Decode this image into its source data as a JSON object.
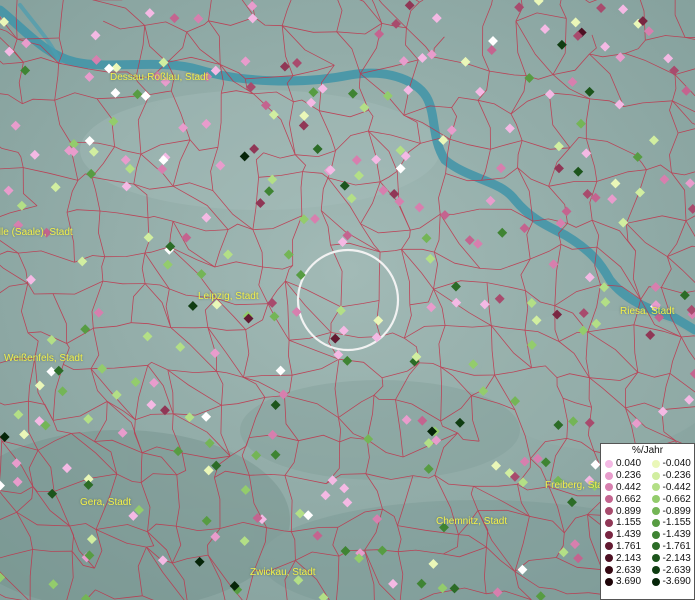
{
  "map": {
    "places": [
      {
        "name": "Dessau-Roßlau, Stadt"
      },
      {
        "name": "Halle (Saale), Stadt"
      },
      {
        "name": "Leipzig, Stadt"
      },
      {
        "name": "Weißenfels, Stadt"
      },
      {
        "name": "Riesa, Stadt"
      },
      {
        "name": "Gera, Stadt"
      },
      {
        "name": "Freiberg, Stadt"
      },
      {
        "name": "Chemnitz, Stadt"
      },
      {
        "name": "Zwickau, Stadt"
      }
    ]
  },
  "legend": {
    "unit": "%/Jahr",
    "positive": [
      {
        "label": "0.040",
        "color": "#f4b9e4"
      },
      {
        "label": "0.236",
        "color": "#e89ccc"
      },
      {
        "label": "0.442",
        "color": "#d77fae"
      },
      {
        "label": "0.662",
        "color": "#c4648f"
      },
      {
        "label": "0.899",
        "color": "#a84b6d"
      },
      {
        "label": "1.155",
        "color": "#903756"
      },
      {
        "label": "1.439",
        "color": "#7a2642"
      },
      {
        "label": "1.761",
        "color": "#631a31"
      },
      {
        "label": "2.143",
        "color": "#4d1123"
      },
      {
        "label": "2.639",
        "color": "#360913"
      },
      {
        "label": "3.690",
        "color": "#1e0408"
      }
    ],
    "negative": [
      {
        "label": "-0.040",
        "color": "#eaf7b8"
      },
      {
        "label": "-0.236",
        "color": "#d1eea0"
      },
      {
        "label": "-0.442",
        "color": "#b3df86"
      },
      {
        "label": "-0.662",
        "color": "#93cc6c"
      },
      {
        "label": "-0.899",
        "color": "#74b556"
      },
      {
        "label": "-1.155",
        "color": "#579c42"
      },
      {
        "label": "-1.439",
        "color": "#3f8433"
      },
      {
        "label": "-1.761",
        "color": "#2c6c27"
      },
      {
        "label": "-2.143",
        "color": "#1d551c"
      },
      {
        "label": "-2.639",
        "color": "#103d12"
      },
      {
        "label": "-3.690",
        "color": "#062509"
      }
    ]
  }
}
